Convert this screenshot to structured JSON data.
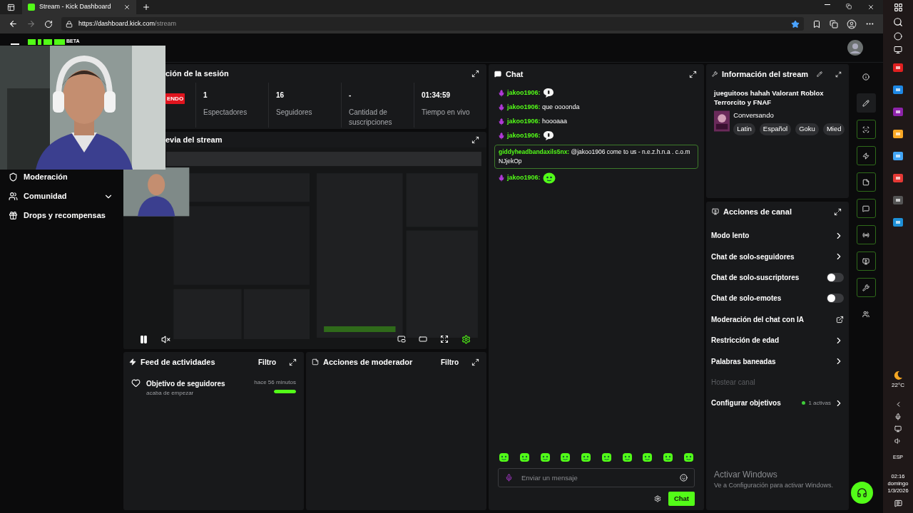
{
  "browser": {
    "tabs": [
      {
        "title": "Stream - Kick Dashboard",
        "selected": true
      }
    ],
    "url_host": "https://dashboard.kick.com",
    "url_path": "/stream"
  },
  "header": {
    "logo_badge": "BETA"
  },
  "sidebar": {
    "items": [
      {
        "label": "Moderación",
        "expandable": false
      },
      {
        "label": "Comunidad",
        "expandable": true
      },
      {
        "label": "Drops y recompensas",
        "expandable": false
      }
    ]
  },
  "session": {
    "title": "ción de la sesión",
    "status": "ENDO",
    "stats": [
      {
        "value": "1",
        "label": "Espectadores"
      },
      {
        "value": "16",
        "label": "Seguidores"
      },
      {
        "value": "-",
        "label": "Cantidad de suscripciones"
      },
      {
        "value": "01:34:59",
        "label": "Tiempo en vivo"
      }
    ]
  },
  "preview": {
    "title": "evia del stream",
    "muted": true
  },
  "activity_feed": {
    "title": "Feed de actividades",
    "filter": "Filtro",
    "items": [
      {
        "title": "Objetivo de seguidores",
        "subtitle": "acaba de empezar",
        "time": "hace 56 minutos",
        "level": 1
      }
    ]
  },
  "mod_actions": {
    "title": "Acciones de moderador",
    "filter": "Filtro"
  },
  "chat": {
    "title": "Chat",
    "messages": [
      {
        "kind": "emote",
        "user": "jakoo1906:",
        "emote": {
          "kind": "bubble"
        }
      },
      {
        "kind": "text",
        "user": "jakoo1906:",
        "text": "que oooonda"
      },
      {
        "kind": "text",
        "user": "jakoo1906:",
        "text": "hoooaaa"
      },
      {
        "kind": "emote",
        "user": "jakoo1906:",
        "emote": {
          "kind": "bubble"
        }
      },
      {
        "kind": "mention",
        "user": "giddyheadbandaxils5nx:",
        "text": "@jakoo1906 come to us - n.e.z.h.n.a . c.o.m NJjekOp"
      },
      {
        "kind": "emote",
        "user": "jakoo1906:",
        "emote": {
          "kind": "blob"
        }
      }
    ],
    "placeholder": "Enviar un mensaje",
    "send": "Chat"
  },
  "stream_info": {
    "title": "Información del stream",
    "stream_title": "jueguitoos hahah Valorant Roblox Terrorcito y FNAF",
    "category": "Conversando",
    "tags": [
      "Latin",
      "Español",
      "Goku",
      "Mied"
    ]
  },
  "channel_actions": {
    "title": "Acciones de canal",
    "items": [
      {
        "kind": "link",
        "label": "Modo lento"
      },
      {
        "kind": "link",
        "label": "Chat de solo-seguidores"
      },
      {
        "kind": "toggle",
        "label": "Chat de solo-suscriptores",
        "on": false
      },
      {
        "kind": "toggle",
        "label": "Chat de solo-emotes",
        "on": false
      },
      {
        "kind": "external",
        "label": "Moderación del chat con IA"
      },
      {
        "kind": "link",
        "label": "Restricción de edad"
      },
      {
        "kind": "link",
        "label": "Palabras baneadas"
      },
      {
        "kind": "disabled",
        "label": "Hostear canal"
      },
      {
        "kind": "goal",
        "label": "Configurar objetivos",
        "badge": "1 activas"
      }
    ]
  },
  "activation_notice": {
    "title": "Activar Windows",
    "text": "Ve a Configuración para activar Windows."
  },
  "taskbar": {
    "weather": "22°C",
    "language": "ESP",
    "time": "02:16",
    "day": "domingo",
    "date": "1/3/2026"
  }
}
